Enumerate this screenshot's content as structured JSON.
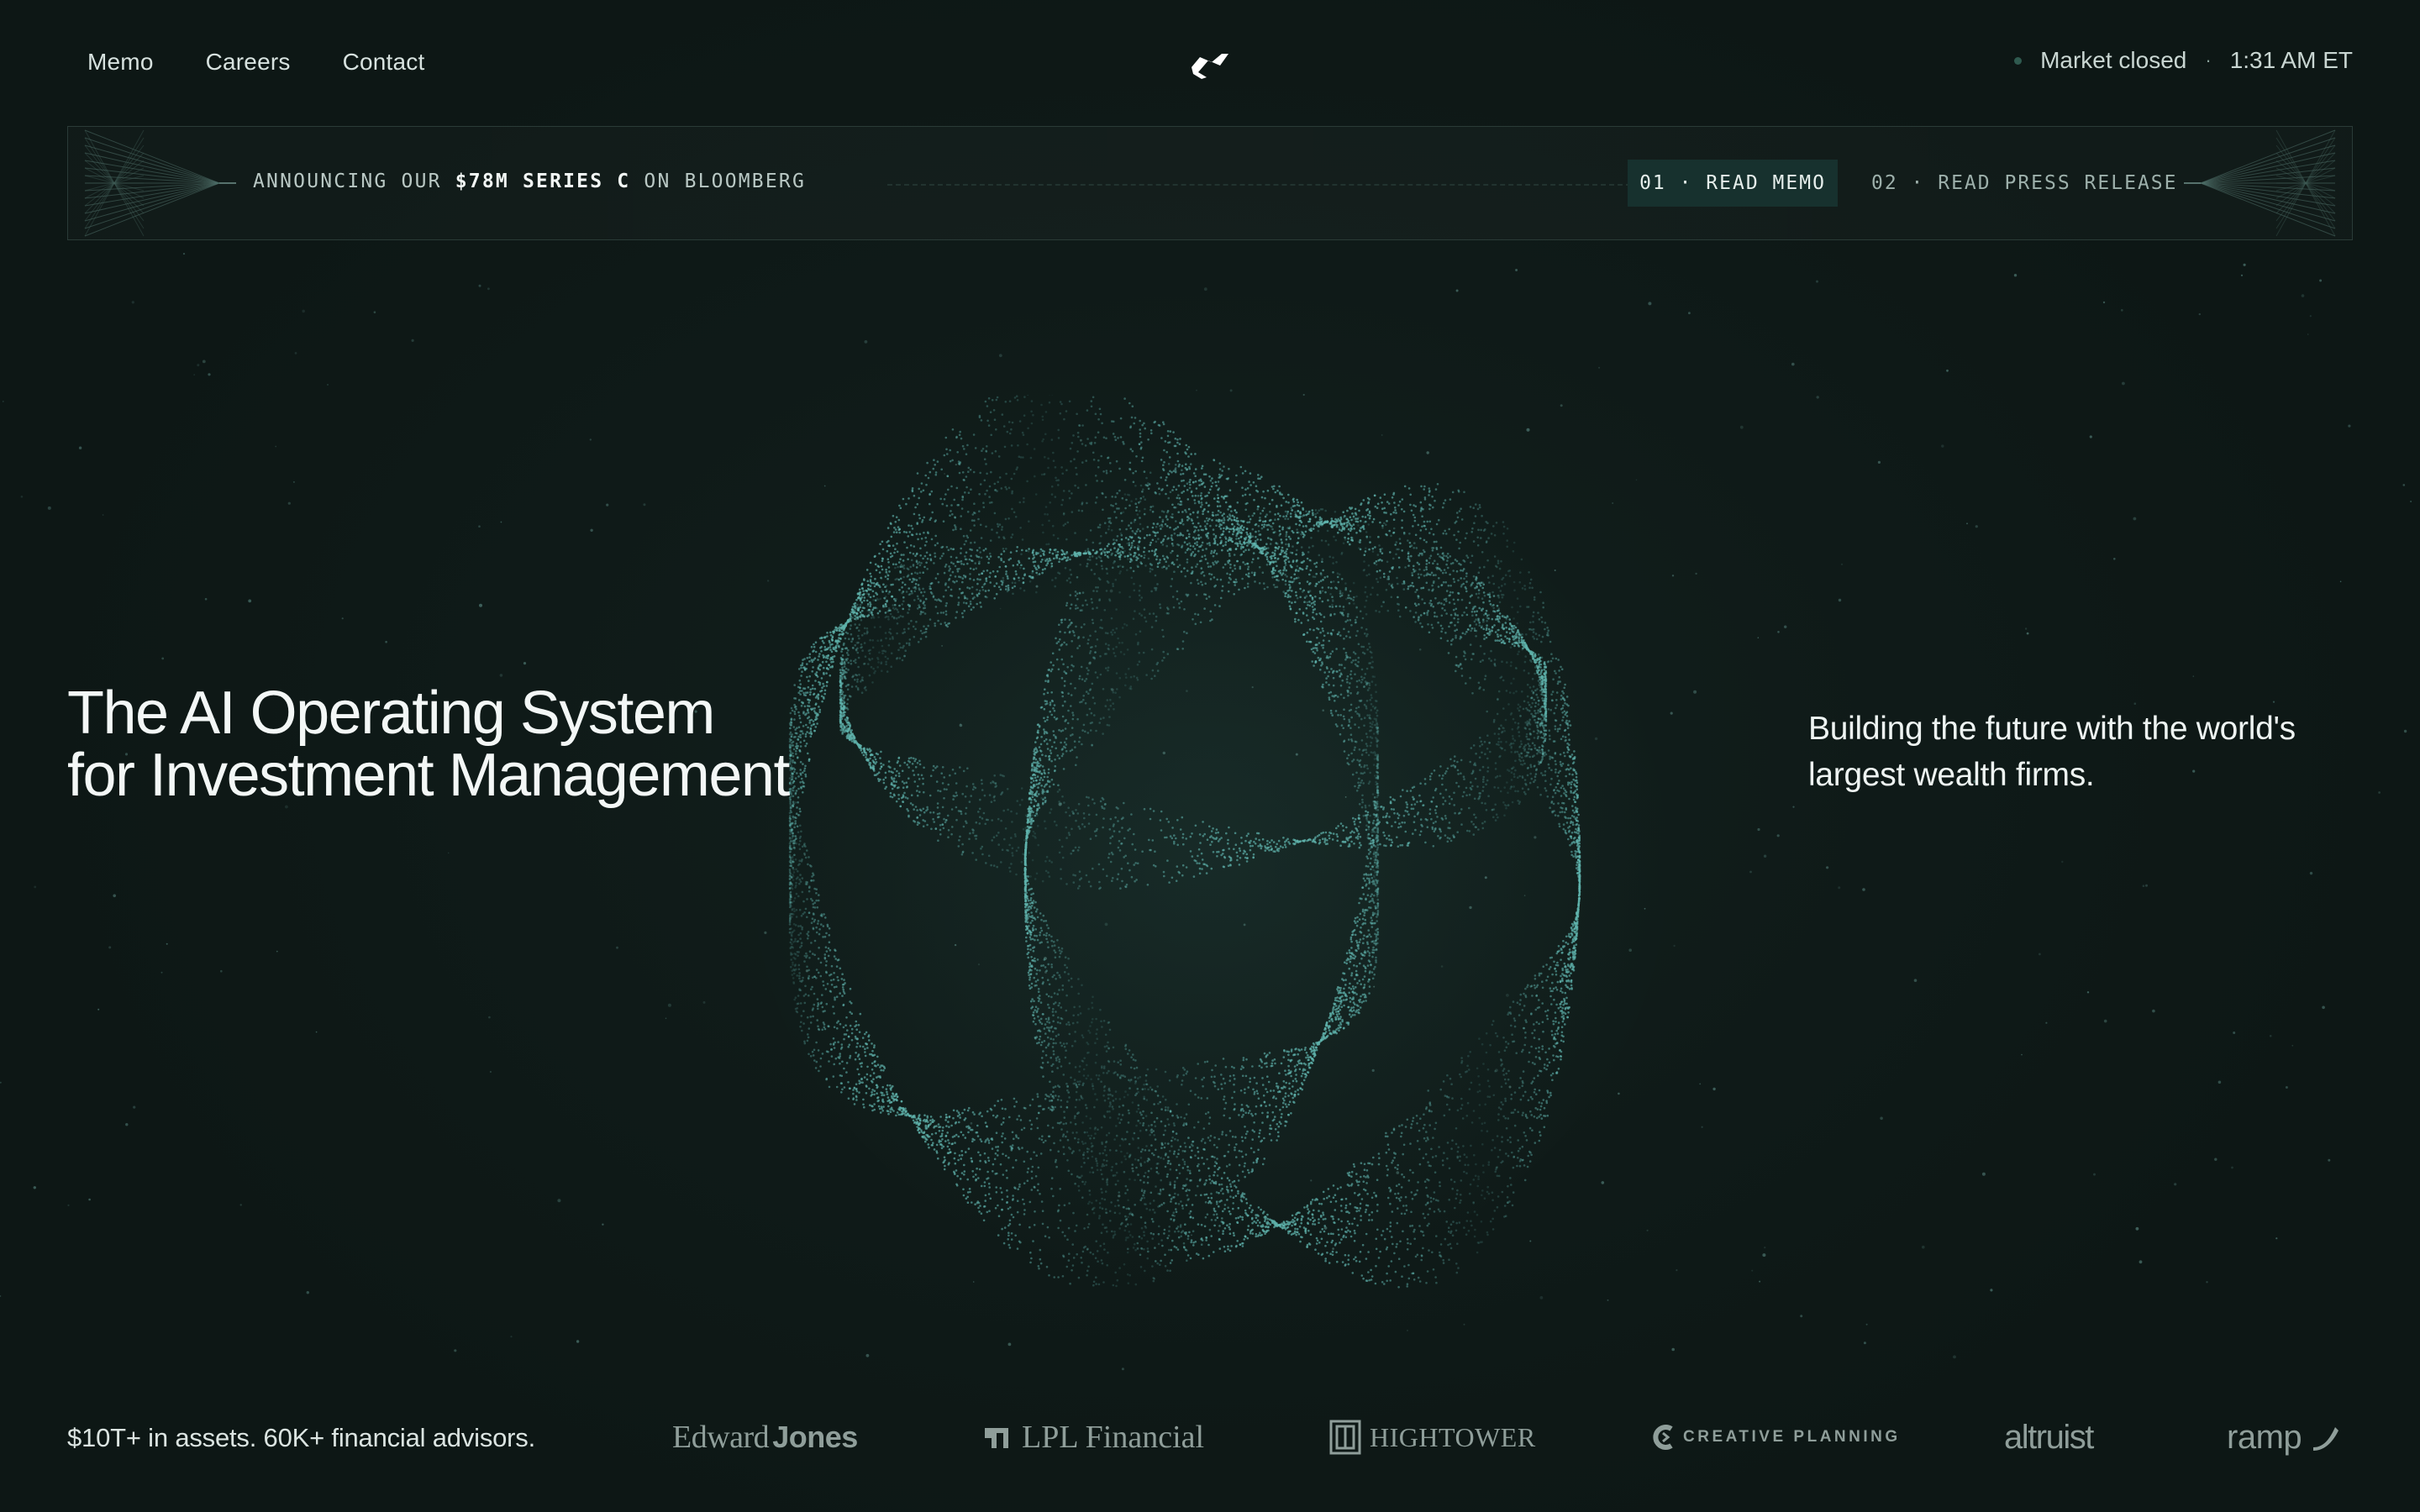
{
  "nav": {
    "links": [
      "Memo",
      "Careers",
      "Contact"
    ],
    "logo_icon": "bolt-flag-icon",
    "market_status": "Market closed",
    "separator": "·",
    "time": "1:31 AM ET"
  },
  "announcement": {
    "prefix": "ANNOUNCING OUR",
    "highlight": "$78M SERIES C",
    "suffix": "ON BLOOMBERG",
    "actions": [
      {
        "label": "01 · READ MEMO"
      },
      {
        "label": "02 · READ PRESS RELEASE"
      }
    ]
  },
  "hero": {
    "title_line1": "The AI Operating System",
    "title_line2": "for Investment Management",
    "subtitle": "Building the future with the world's largest wealth firms."
  },
  "footer": {
    "stats": "$10T+ in assets. 60K+ financial advisors.",
    "partners": {
      "edward_a": "Edward",
      "edward_b": "Jones",
      "lpl": "LPL Financial",
      "hightower": "HIGHTOWER",
      "creative": "CREATIVE PLANNING",
      "altruist": "altruist",
      "ramp": "ramp"
    }
  },
  "colors": {
    "background": "#0f1a18",
    "accent_teal": "#5fb3ad",
    "button_bg": "#17312e",
    "logo_gray": "#8f9e9a"
  }
}
